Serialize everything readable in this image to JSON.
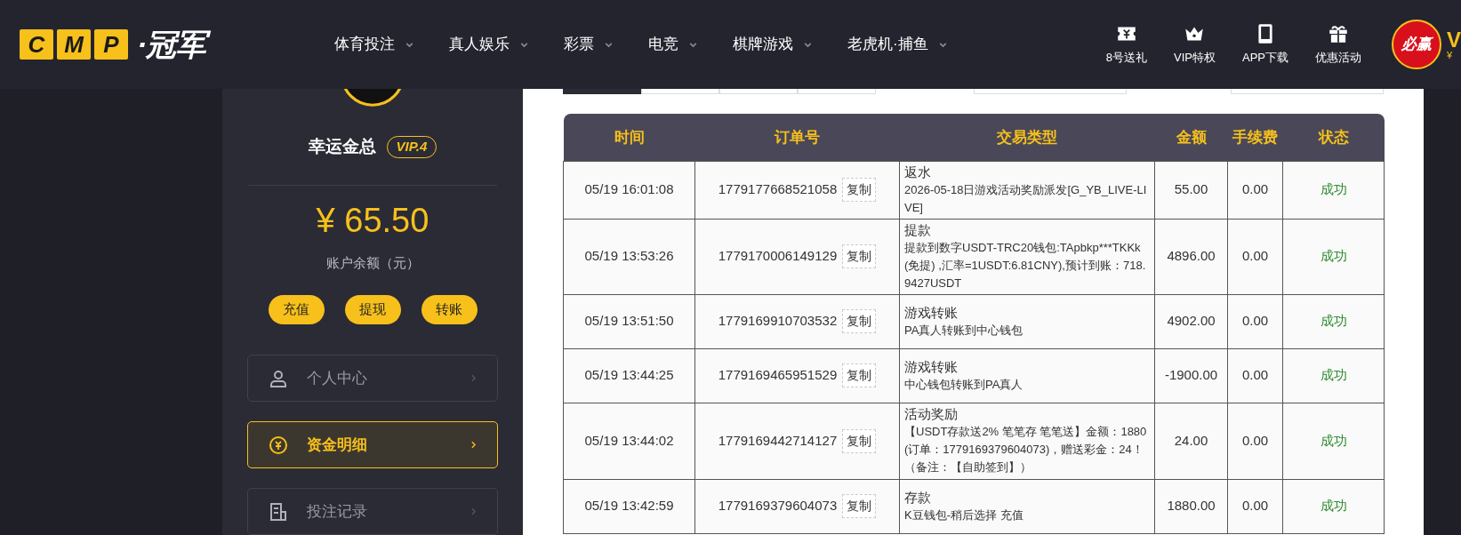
{
  "header": {
    "logo": {
      "letters": [
        "C",
        "M",
        "P"
      ],
      "text": "·冠军"
    },
    "nav": [
      {
        "label": "体育投注"
      },
      {
        "label": "真人娱乐"
      },
      {
        "label": "彩票"
      },
      {
        "label": "电竞"
      },
      {
        "label": "棋牌游戏"
      },
      {
        "label": "老虎机·捕鱼"
      }
    ],
    "actions": [
      {
        "kind": "ticket",
        "label": "8号送礼"
      },
      {
        "kind": "crown",
        "label": "VIP特权"
      },
      {
        "kind": "tablet",
        "label": "APP下载"
      },
      {
        "kind": "gift",
        "label": "优惠活动"
      }
    ],
    "avatar_text": "必赢",
    "edge_text": "V",
    "edge_subtext": "¥"
  },
  "sidebar": {
    "username": "幸运金总",
    "vip": "VIP.4",
    "balance": "¥ 65.50",
    "balance_label": "账户余额（元）",
    "buttons": [
      "充值",
      "提现",
      "转账"
    ],
    "menu": [
      {
        "kind": "user",
        "label": "个人中心",
        "selected": false
      },
      {
        "kind": "coin",
        "label": "资金明细",
        "selected": true
      },
      {
        "kind": "doc",
        "label": "投注记录",
        "selected": false
      }
    ]
  },
  "table": {
    "columns": [
      "时间",
      "订单号",
      "交易类型",
      "金额",
      "手续费",
      "状态"
    ],
    "rows": [
      {
        "time": "05/19 16:01:08",
        "order": "1779177668521058",
        "copy_label": "复制",
        "type": "返水",
        "detail": "2026-05-18日游戏活动奖励派发[G_YB_LIVE-LIVE]",
        "amount": "55.00",
        "fee": "0.00",
        "status": "成功"
      },
      {
        "time": "05/19 13:53:26",
        "order": "1779170006149129",
        "copy_label": "复制",
        "type": "提款",
        "detail": "提款到数字USDT-TRC20钱包:TApbkp***TKKk(免提) ,汇率=1USDT:6.81CNY),预计到账：718.9427USDT",
        "amount": "4896.00",
        "fee": "0.00",
        "status": "成功"
      },
      {
        "time": "05/19 13:51:50",
        "order": "1779169910703532",
        "copy_label": "复制",
        "type": "游戏转账",
        "detail": "PA真人转账到中心钱包",
        "amount": "4902.00",
        "fee": "0.00",
        "status": "成功"
      },
      {
        "time": "05/19 13:44:25",
        "order": "1779169465951529",
        "copy_label": "复制",
        "type": "游戏转账",
        "detail": "中心钱包转账到PA真人",
        "amount": "-1900.00",
        "fee": "0.00",
        "status": "成功"
      },
      {
        "time": "05/19 13:44:02",
        "order": "1779169442714127",
        "copy_label": "复制",
        "type": "活动奖励",
        "detail": "【USDT存款送2% 笔笔存 笔笔送】金额：1880(订单：1779169379604073)，赠送彩金：24！（备注：【自助签到】）",
        "amount": "24.00",
        "fee": "0.00",
        "status": "成功"
      },
      {
        "time": "05/19 13:42:59",
        "order": "1779169379604073",
        "copy_label": "复制",
        "type": "存款",
        "detail": "K豆钱包-稍后选择 充值",
        "amount": "1880.00",
        "fee": "0.00",
        "status": "成功"
      }
    ]
  }
}
